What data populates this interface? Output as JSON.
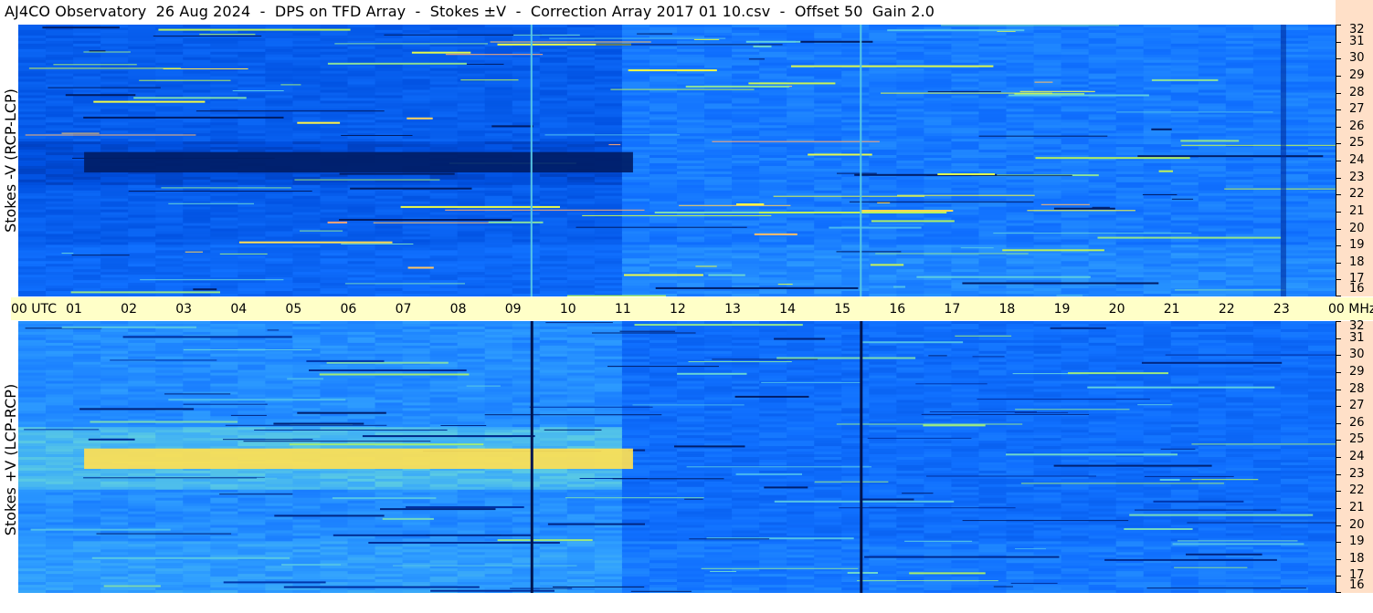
{
  "title": "AJ4CO Observatory  26 Aug 2024  -  DPS on TFD Array  -  Stokes ±V  -  Correction Array 2017 01 10.csv  -  Offset 50  Gain 2.0",
  "chart_data": [
    {
      "type": "heatmap",
      "panel": "top",
      "ylabel": "Stokes -V (RCP-LCP)",
      "x_unit": "UTC",
      "y_unit": "MHz",
      "xlim": [
        0,
        24
      ],
      "ylim": [
        16,
        32
      ],
      "x_ticks": [
        "00 UTC",
        "01",
        "02",
        "03",
        "04",
        "05",
        "06",
        "07",
        "08",
        "09",
        "10",
        "11",
        "12",
        "13",
        "14",
        "15",
        "16",
        "17",
        "18",
        "19",
        "20",
        "21",
        "22",
        "23",
        "00 MHz"
      ],
      "y_ticks": [
        "32",
        "31",
        "30",
        "29",
        "28",
        "27",
        "26",
        "25",
        "24",
        "23",
        "22",
        "21",
        "20",
        "19",
        "18",
        "17",
        "16"
      ],
      "colormap": [
        "#001040",
        "#0030a0",
        "#0050e0",
        "#1070ff",
        "#30a0ff",
        "#60d0e0",
        "#b0f060",
        "#ffff40",
        "#ff60a0"
      ],
      "features": [
        {
          "label": "dark band",
          "t_start": 1.2,
          "t_end": 11.2,
          "f_low": 23.3,
          "f_high": 24.5,
          "level": 0.05
        },
        {
          "label": "vertical line",
          "t": 9.35
        },
        {
          "label": "vertical line",
          "t": 15.35
        },
        {
          "label": "darker region",
          "t_start": 23.0,
          "t_end": 23.1
        }
      ]
    },
    {
      "type": "heatmap",
      "panel": "bottom",
      "ylabel": "Stokes +V (LCP-RCP)",
      "x_unit": "UTC",
      "y_unit": "MHz",
      "xlim": [
        0,
        24
      ],
      "ylim": [
        16,
        32
      ],
      "y_ticks": [
        "32",
        "31",
        "30",
        "29",
        "28",
        "27",
        "26",
        "25",
        "24",
        "23",
        "22",
        "21",
        "20",
        "19",
        "18",
        "17",
        "16"
      ],
      "features": [
        {
          "label": "bright band",
          "t_start": 1.2,
          "t_end": 11.2,
          "f_low": 23.3,
          "f_high": 24.5,
          "level": 0.9
        },
        {
          "label": "vertical line",
          "t": 9.35
        },
        {
          "label": "vertical line",
          "t": 15.35
        }
      ]
    }
  ]
}
